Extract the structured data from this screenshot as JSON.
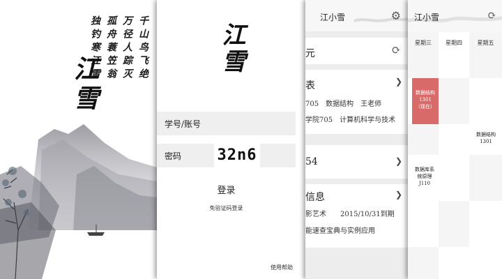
{
  "splash": {
    "poem_columns": [
      "千山鸟飞绝",
      "万径人踪灭",
      "孤舟蓑笠翁",
      "独钓寒江雪"
    ],
    "brand": "江雪"
  },
  "login": {
    "brand": "江雪",
    "account_label": "学号/账号",
    "password_label": "密码",
    "captcha": "32n6",
    "login_button": "登录",
    "alt_login": "免验证码登录",
    "help": "使用帮助"
  },
  "home": {
    "title": "江小雪",
    "balance_label": "元",
    "schedule_title": "表",
    "schedule_lines": [
      "705　数据结构　王老师",
      "学院705　计算机科学与技术"
    ],
    "card3_value": "54",
    "info_title": "信息",
    "info_lines": [
      "影艺术　　2015/10/31到期",
      "能速查宝典与实例应用"
    ]
  },
  "timetable": {
    "title": "江小雪",
    "days": [
      "星期三",
      "星期四",
      "星期五"
    ],
    "courses": [
      {
        "name": "数据结构",
        "room": "1301",
        "note": "（现在）",
        "active": true
      },
      {
        "name": "数据结构",
        "room": "1301"
      },
      {
        "name": "数据库系统原理",
        "room": "J110"
      }
    ]
  },
  "colors": {
    "active_course": "#d96a6a",
    "page_bg": "#ffffff",
    "card_bg": "#ededed"
  },
  "icons": [
    "gear-icon",
    "refresh-icon",
    "chevron-right-icon"
  ]
}
